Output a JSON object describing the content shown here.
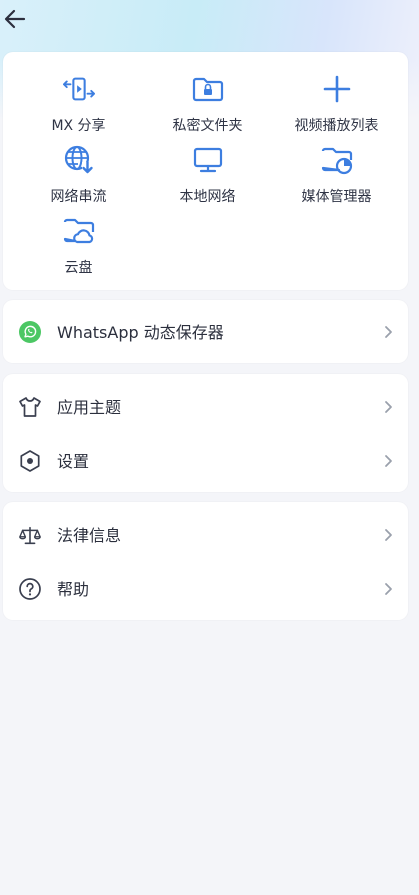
{
  "header": {
    "back_icon": "arrow-left-icon"
  },
  "quick_actions": [
    {
      "label": "MX 分享",
      "icon": "share-transfer-icon"
    },
    {
      "label": "私密文件夹",
      "icon": "locked-folder-icon"
    },
    {
      "label": "视频播放列表",
      "icon": "plus-icon"
    },
    {
      "label": "网络串流",
      "icon": "network-stream-icon"
    },
    {
      "label": "本地网络",
      "icon": "monitor-icon"
    },
    {
      "label": "媒体管理器",
      "icon": "media-folder-icon"
    },
    {
      "label": "云盘",
      "icon": "cloud-folder-icon"
    }
  ],
  "whatsapp": {
    "label": "WhatsApp 动态保存器",
    "icon": "whatsapp-icon",
    "accent": "#4cc764"
  },
  "settings_group": [
    {
      "label": "应用主题",
      "icon": "tshirt-icon"
    },
    {
      "label": "设置",
      "icon": "hexagon-settings-icon"
    }
  ],
  "info_group": [
    {
      "label": "法律信息",
      "icon": "scales-icon"
    },
    {
      "label": "帮助",
      "icon": "help-circle-icon"
    }
  ],
  "colors": {
    "accent": "#3d7ee0",
    "text": "#2b2f3d",
    "chevron": "#9aa0ac"
  }
}
